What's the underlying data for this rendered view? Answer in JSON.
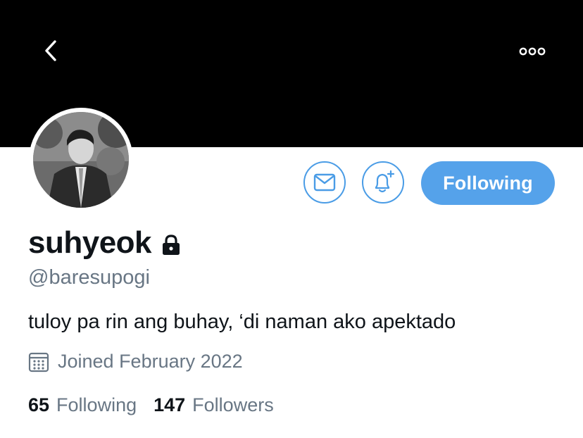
{
  "header": {
    "back_icon": "chevron-left-icon",
    "more_icon": "more-dots-icon"
  },
  "profile": {
    "display_name": "suhyeok",
    "handle": "@baresupogi",
    "bio": "tuloy pa rin ang buhay, ‘di naman ako apektado",
    "joined": "Joined February 2022",
    "protected": true
  },
  "actions": {
    "message_icon": "envelope-icon",
    "notify_icon": "bell-plus-icon",
    "follow_label": "Following"
  },
  "stats": {
    "following_count": "65",
    "following_label": "Following",
    "followers_count": "147",
    "followers_label": "Followers"
  },
  "colors": {
    "accent": "#55a2ea",
    "secondary_text": "#687684",
    "banner": "#000000"
  }
}
